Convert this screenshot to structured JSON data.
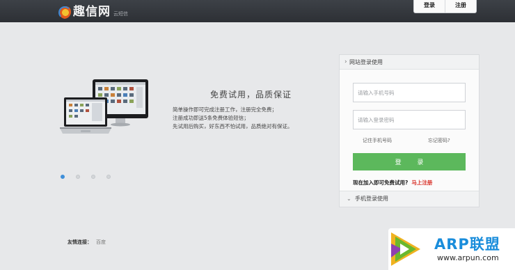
{
  "header": {
    "logo_text": "趣信网",
    "logo_sub": "云短信",
    "tabs": [
      "登录",
      "注册"
    ]
  },
  "hero": {
    "title": "免费试用，品质保证",
    "lines": [
      "简单操作即可完成注册工作，注册完全免费；",
      "注册成功即送5条免费体验短信；",
      "先试用后购买，好东西不怕试用，品质绝对有保证。"
    ],
    "slides": 4,
    "active_slide": 0
  },
  "friend_links": {
    "label": "友情连接：",
    "links": [
      "百度"
    ]
  },
  "login_panel": {
    "header": "网站登录使用",
    "phone_placeholder": "请输入手机号码",
    "password_placeholder": "请输入登录密码",
    "remember": "记住手机号码",
    "forgot": "忘记密码?",
    "login_button": "登 录",
    "free_text": "现在加入即可免费试用?",
    "register_link": "马上注册",
    "footer": "手机登录使用",
    "accent_color": "#5cb85c"
  },
  "watermark": {
    "title": "ARP联盟",
    "url": "www.arpun.com"
  }
}
